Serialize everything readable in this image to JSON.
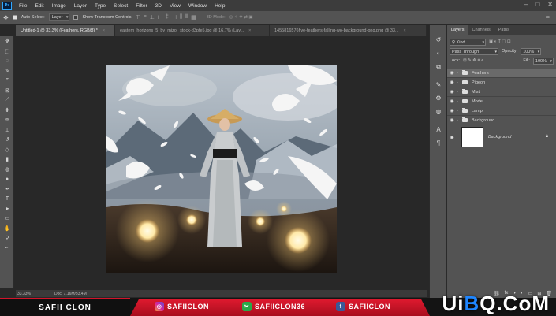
{
  "menu": {
    "logo": "Ps",
    "items": [
      "File",
      "Edit",
      "Image",
      "Layer",
      "Type",
      "Select",
      "Filter",
      "3D",
      "View",
      "Window",
      "Help"
    ]
  },
  "options": {
    "auto_select_label": "Auto-Select:",
    "auto_select_value": "Layer",
    "transform_label": "Show Transform Controls",
    "mode_3d": "3D Mode:"
  },
  "doc_tabs": [
    {
      "label": "Untitled-1 @ 33.3% (Feathers, RGB/8) *",
      "active": true
    },
    {
      "label": "eastern_horizons_5_by_mizol_stock-d3pfe5.jpg @ 16.7% (Lay...",
      "active": false
    },
    {
      "label": "1455816576five-feathers-falling-wo-background-png.png @ 33...",
      "active": false
    }
  ],
  "status": {
    "zoom": "33.33%",
    "doc": "Doc: 7.16M/33.4M"
  },
  "panel": {
    "tabs": [
      "Layers",
      "Channels",
      "Paths"
    ],
    "filter_kind": "Kind",
    "blend_mode": "Pass Through",
    "opacity_label": "Opacity:",
    "opacity_value": "100%",
    "lock_label": "Lock:",
    "fill_label": "Fill:",
    "fill_value": "100%",
    "layers": [
      {
        "name": "Feathers",
        "selected": true
      },
      {
        "name": "Pigeon",
        "selected": false
      },
      {
        "name": "Mist",
        "selected": false
      },
      {
        "name": "Model",
        "selected": false
      },
      {
        "name": "Lamp",
        "selected": false
      },
      {
        "name": "Background",
        "selected": false
      }
    ],
    "background_layer": "Background"
  },
  "banner": {
    "name": "SAFII CLON",
    "instagram": "SAFIICLON",
    "channel": "SAFIICLON36",
    "facebook": "SAFIICLON"
  },
  "watermark": {
    "pre": "Ui",
    "o": "B",
    "post": "Q.CoM"
  },
  "colors": {
    "accent": "#31a8ff",
    "banner_red": "#e01a2f"
  }
}
